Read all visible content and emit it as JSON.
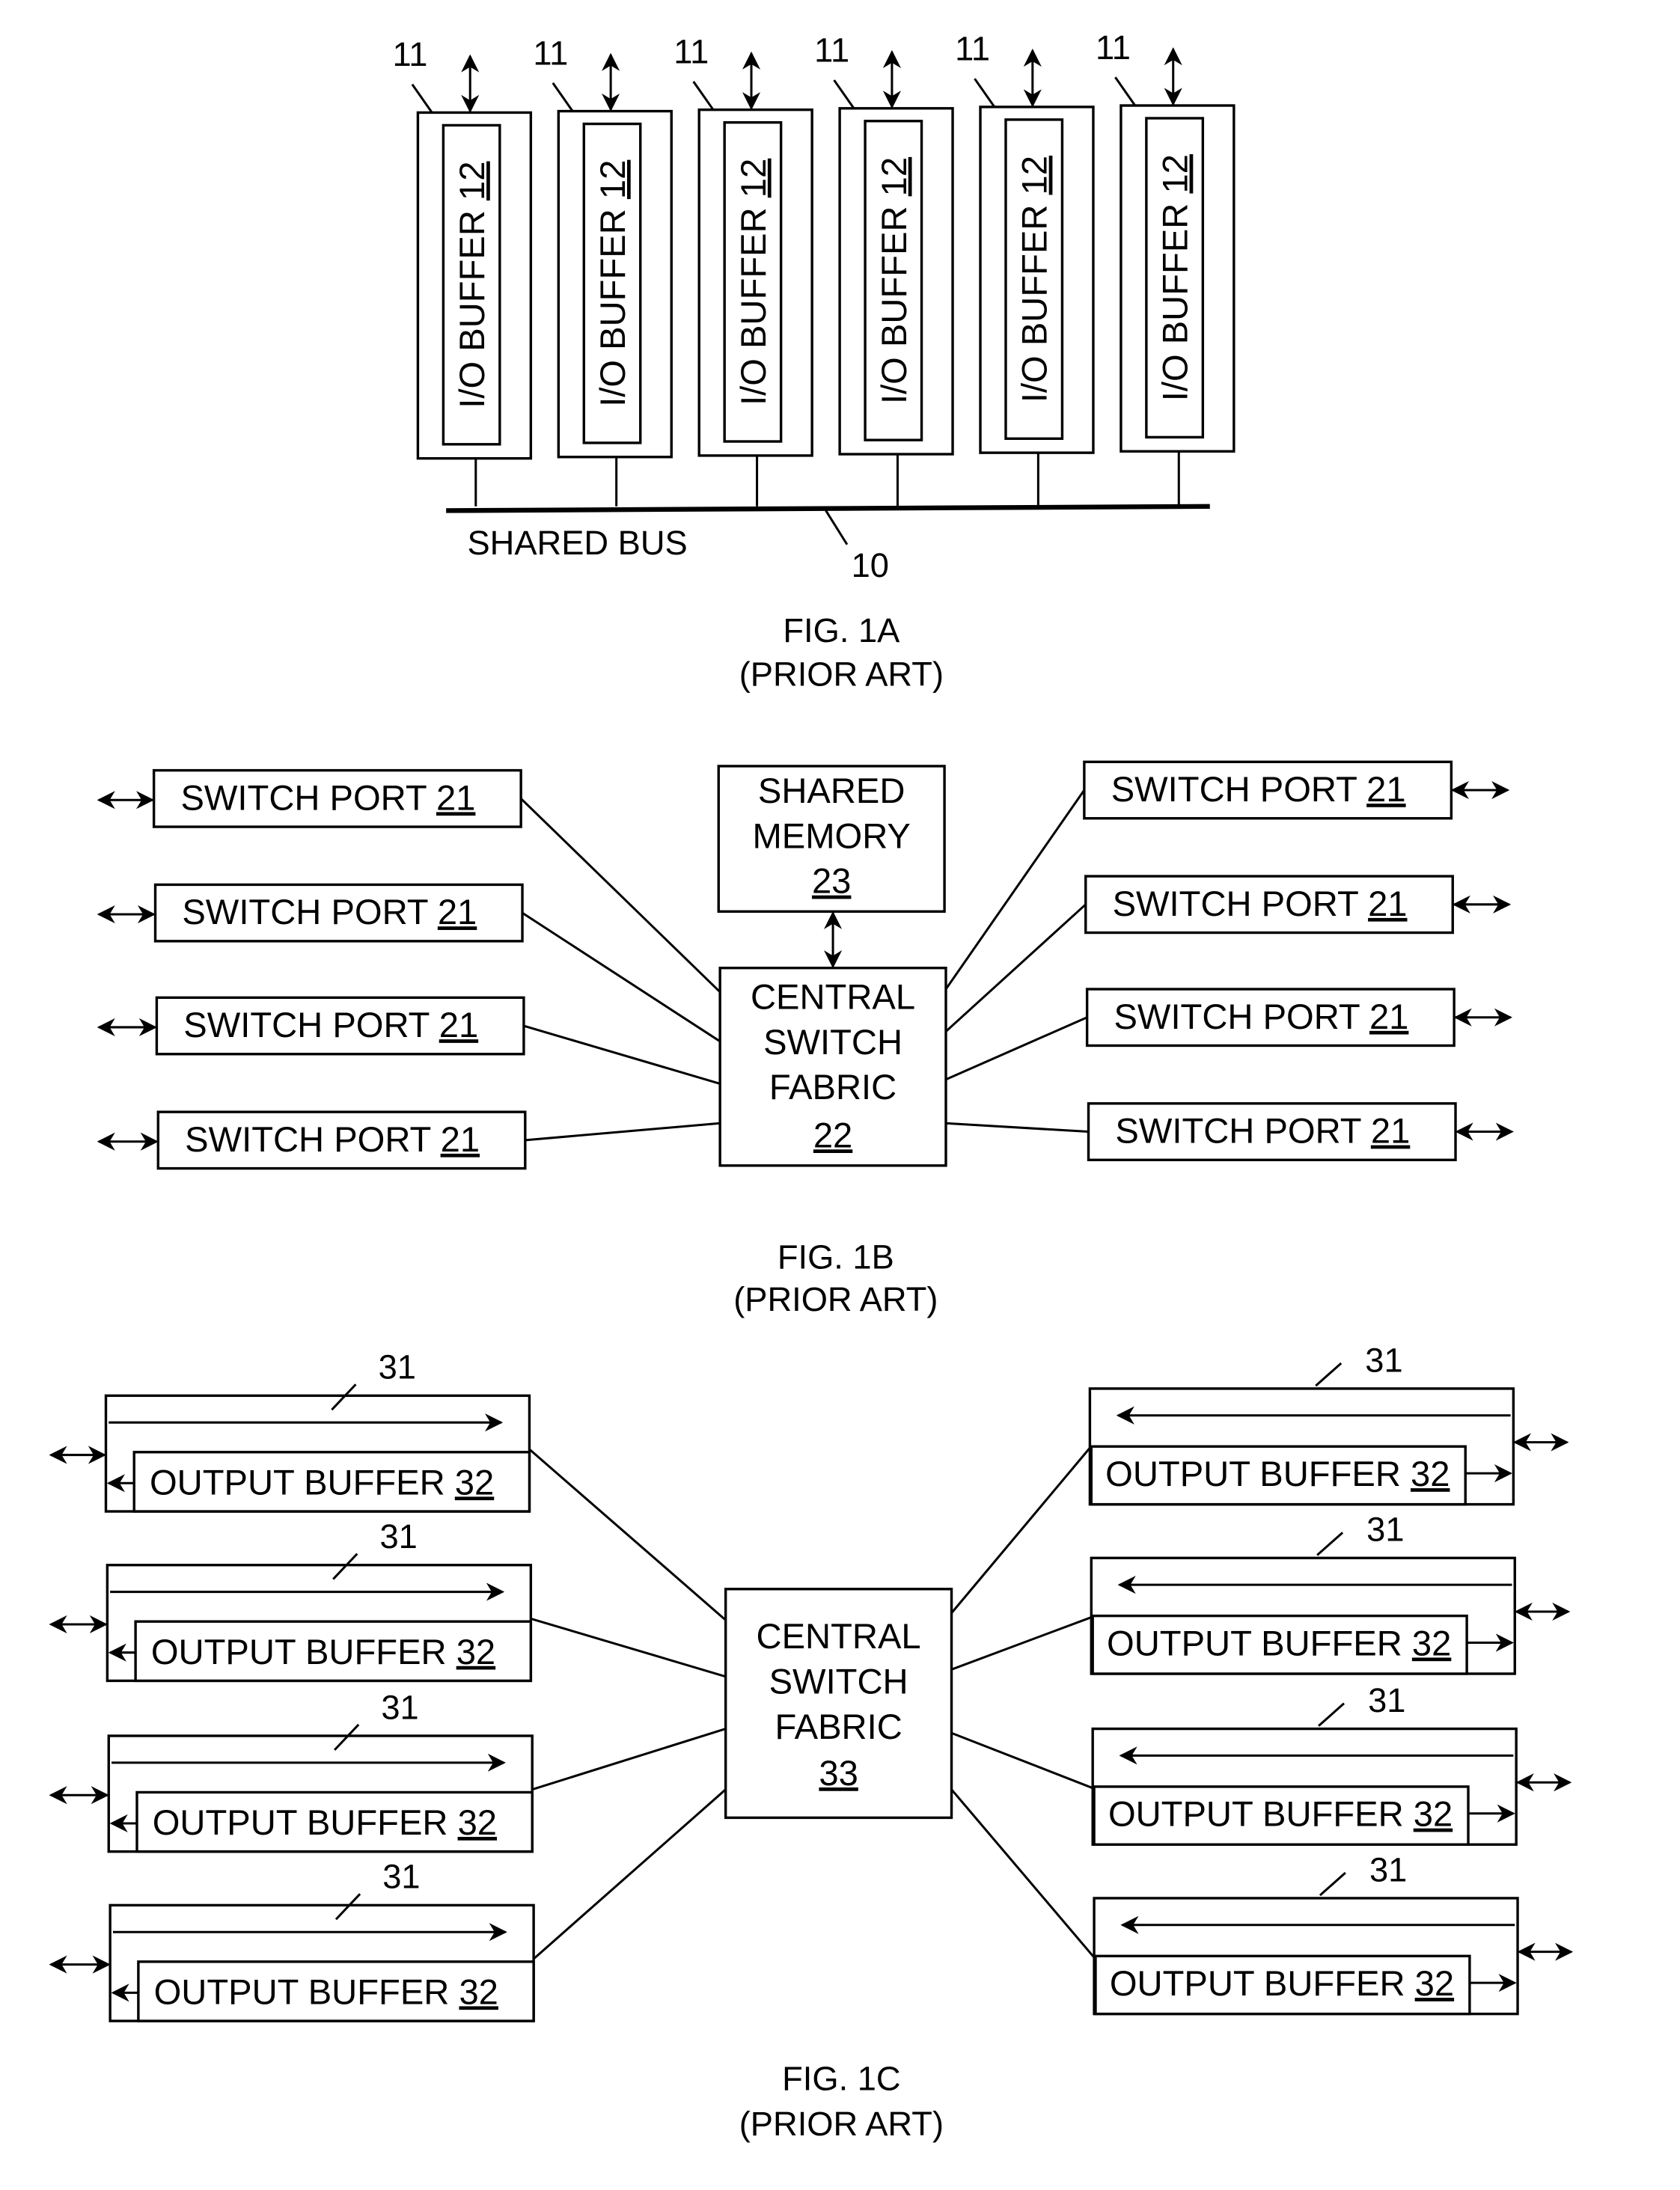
{
  "fig1a": {
    "caption": "FIG. 1A",
    "subcaption": "(PRIOR ART)",
    "port_ref": "11",
    "buffer_text": "I/O BUFFER ",
    "buffer_ref": "12",
    "bus_label": "SHARED BUS",
    "bus_ref": "10",
    "port_count": 6
  },
  "fig1b": {
    "caption": "FIG. 1B",
    "subcaption": "(PRIOR ART)",
    "port_text": "SWITCH PORT ",
    "port_ref": "21",
    "memory_lines": [
      "SHARED",
      "MEMORY"
    ],
    "memory_ref": "23",
    "fabric_lines": [
      "CENTRAL",
      "SWITCH",
      "FABRIC"
    ],
    "fabric_ref": "22",
    "ports_per_side": 4
  },
  "fig1c": {
    "caption": "FIG. 1C",
    "subcaption": "(PRIOR ART)",
    "port_ref": "31",
    "buffer_text": "OUTPUT BUFFER ",
    "buffer_ref": "32",
    "fabric_lines": [
      "CENTRAL",
      "SWITCH",
      "FABRIC"
    ],
    "fabric_ref": "33",
    "ports_per_side": 4
  }
}
